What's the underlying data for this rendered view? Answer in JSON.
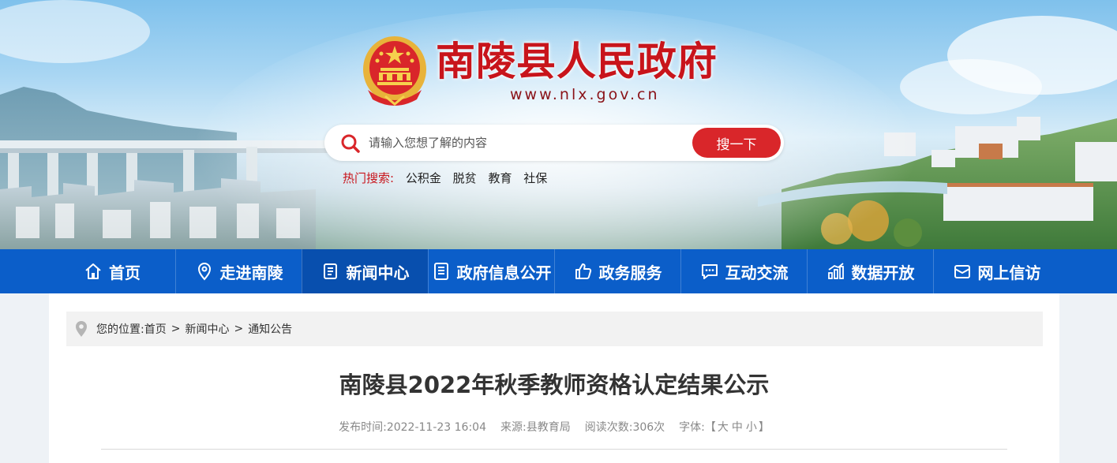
{
  "header": {
    "site_title": "南陵县人民政府",
    "site_url": "www.nlx.gov.cn"
  },
  "search": {
    "placeholder": "请输入您想了解的内容",
    "button_label": "搜一下",
    "hot_label": "热门搜索:",
    "hot_items": [
      "公积金",
      "脱贫",
      "教育",
      "社保"
    ]
  },
  "nav": {
    "items": [
      {
        "label": "首页",
        "icon": "home-icon"
      },
      {
        "label": "走进南陵",
        "icon": "location-pin-icon"
      },
      {
        "label": "新闻中心",
        "icon": "news-document-icon"
      },
      {
        "label": "政府信息公开",
        "icon": "info-document-icon"
      },
      {
        "label": "政务服务",
        "icon": "thumbs-up-icon"
      },
      {
        "label": "互动交流",
        "icon": "chat-bubble-icon"
      },
      {
        "label": "数据开放",
        "icon": "bar-chart-icon"
      },
      {
        "label": "网上信访",
        "icon": "mail-icon"
      }
    ],
    "active_index": 2,
    "bg_color": "#0b5ec9"
  },
  "breadcrumb": {
    "prefix": "您的位置:",
    "items": [
      "首页",
      "新闻中心",
      "通知公告"
    ],
    "separator": ">"
  },
  "article": {
    "title": "南陵县2022年秋季教师资格认定结果公示",
    "publish_label": "发布时间:",
    "publish_time": "2022-11-23 16:04",
    "source_label": "来源:",
    "source": "县教育局",
    "views_label": "阅读次数:",
    "views": "306次",
    "font_label": "字体:",
    "font_open": "【",
    "font_sizes": [
      "大",
      "中",
      "小"
    ],
    "font_close": "】"
  },
  "colors": {
    "brand_red": "#c8141b",
    "search_button": "#d9262a",
    "nav_blue": "#0b5ec9"
  }
}
